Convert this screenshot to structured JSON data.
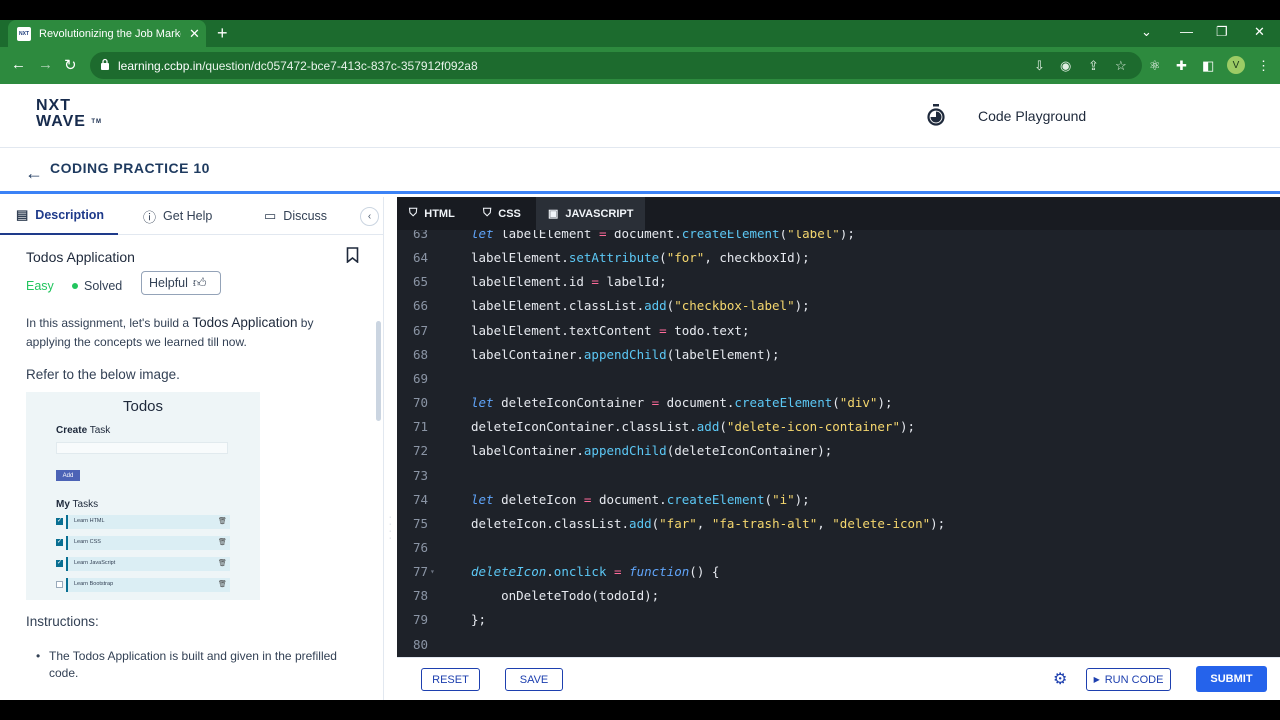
{
  "browser": {
    "tab_title": "Revolutionizing the Job Market |",
    "tab_close": "✕",
    "new_tab": "+",
    "url_domain": "learning.ccbp.in",
    "url_path": "/question/dc057472-bce7-413c-837c-357912f092a8",
    "avatar_letter": "V",
    "win_min": "—",
    "win_restore": "❐",
    "win_close": "✕",
    "tab_search": "⌄"
  },
  "header": {
    "logo_line1": "NXT",
    "logo_line2": "WAVE",
    "logo_tm": "TM",
    "playground": "Code Playground"
  },
  "subheader": {
    "back_arrow": "←",
    "title": "CODING PRACTICE 10"
  },
  "left_tabs": [
    {
      "label": "Description",
      "icon": "document-icon"
    },
    {
      "label": "Get Help",
      "icon": "help-icon"
    },
    {
      "label": "Discuss",
      "icon": "chat-icon"
    }
  ],
  "collapse": "‹",
  "question": {
    "title": "Todos Application",
    "difficulty": "Easy",
    "status": "Solved",
    "helpful": "Helpful",
    "intro_a": "In this assignment, let's build a ",
    "intro_hl": "Todos Application",
    "intro_b": " by applying the concepts we learned till now.",
    "refer": "Refer to the below image.",
    "instructions_head": "Instructions:",
    "instruction_1": "The Todos Application is built and given in the prefilled code."
  },
  "preview": {
    "title": "Todos",
    "create_a": "Create",
    "create_b": " Task",
    "add": "Add",
    "my_a": "My",
    "my_b": " Tasks",
    "tasks": [
      {
        "label": "Learn HTML",
        "checked": true
      },
      {
        "label": "Learn CSS",
        "checked": true
      },
      {
        "label": "Learn JavaScript",
        "checked": true
      },
      {
        "label": "Learn Bootstrap",
        "checked": false
      }
    ]
  },
  "editor_tabs": [
    {
      "label": "HTML",
      "active": false
    },
    {
      "label": "CSS",
      "active": false
    },
    {
      "label": "JAVASCRIPT",
      "active": true
    }
  ],
  "code_lines": [
    {
      "n": "63",
      "html": "<span class=\"kw\">let</span> labelElement <span class=\"op\">=</span> document.<span class=\"fn\">createElement</span>(<span class=\"str\">\"label\"</span>);"
    },
    {
      "n": "64",
      "html": "labelElement.<span class=\"fn\">setAttribute</span>(<span class=\"str\">\"for\"</span>, checkboxId);"
    },
    {
      "n": "65",
      "html": "labelElement.id <span class=\"op\">=</span> labelId;"
    },
    {
      "n": "66",
      "html": "labelElement.classList.<span class=\"fn\">add</span>(<span class=\"str\">\"checkbox-label\"</span>);"
    },
    {
      "n": "67",
      "html": "labelElement.textContent <span class=\"op\">=</span> todo.text;"
    },
    {
      "n": "68",
      "html": "labelContainer.<span class=\"fn\">appendChild</span>(labelElement);"
    },
    {
      "n": "69",
      "html": ""
    },
    {
      "n": "70",
      "html": "<span class=\"kw\">let</span> deleteIconContainer <span class=\"op\">=</span> document.<span class=\"fn\">createElement</span>(<span class=\"str\">\"div\"</span>);"
    },
    {
      "n": "71",
      "html": "deleteIconContainer.classList.<span class=\"fn\">add</span>(<span class=\"str\">\"delete-icon-container\"</span>);"
    },
    {
      "n": "72",
      "html": "labelContainer.<span class=\"fn\">appendChild</span>(deleteIconContainer);"
    },
    {
      "n": "73",
      "html": ""
    },
    {
      "n": "74",
      "html": "<span class=\"kw\">let</span> deleteIcon <span class=\"op\">=</span> document.<span class=\"fn\">createElement</span>(<span class=\"str\">\"i\"</span>);"
    },
    {
      "n": "75",
      "html": "deleteIcon.classList.<span class=\"fn\">add</span>(<span class=\"str\">\"far\"</span>, <span class=\"str\">\"fa-trash-alt\"</span>, <span class=\"str\">\"delete-icon\"</span>);"
    },
    {
      "n": "76",
      "html": ""
    },
    {
      "n": "77",
      "html": "<span class=\"idi\">deleteIcon</span>.<span class=\"fn\">onclick</span> <span class=\"op\">=</span> <span class=\"kw\">function</span>() {",
      "fold": true
    },
    {
      "n": "78",
      "html": "    onDeleteTodo(todoId);"
    },
    {
      "n": "79",
      "html": "};"
    },
    {
      "n": "80",
      "html": ""
    }
  ],
  "actions": {
    "reset": "RESET",
    "save": "SAVE",
    "run": "RUN CODE",
    "submit": "SUBMIT"
  }
}
